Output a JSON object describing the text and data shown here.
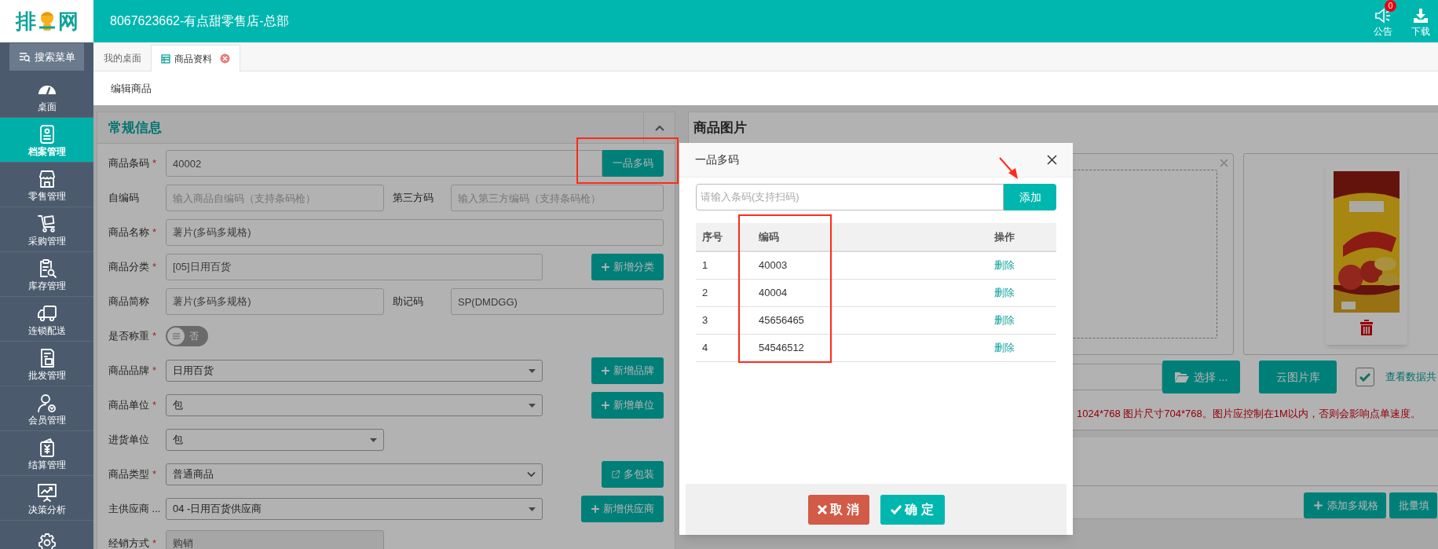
{
  "logo": {
    "left": "排",
    "right": "网"
  },
  "header": {
    "title": "8067623662-有点甜零售店-总部",
    "notice": {
      "label": "公告",
      "badge": "0"
    },
    "download": {
      "label": "下载"
    }
  },
  "sidebar": {
    "search": "搜索菜单",
    "items": [
      {
        "label": "桌面",
        "selected": false
      },
      {
        "label": "档案管理",
        "selected": true
      },
      {
        "label": "零售管理",
        "selected": false
      },
      {
        "label": "采购管理",
        "selected": false
      },
      {
        "label": "库存管理",
        "selected": false
      },
      {
        "label": "连锁配送",
        "selected": false
      },
      {
        "label": "批发管理",
        "selected": false
      },
      {
        "label": "会员管理",
        "selected": false
      },
      {
        "label": "结算管理",
        "selected": false
      },
      {
        "label": "决策分析",
        "selected": false
      },
      {
        "selected": false
      }
    ]
  },
  "tabs": [
    {
      "label": "我的桌面",
      "selected": false,
      "closable": false
    },
    {
      "label": "商品资料",
      "selected": true,
      "closable": true
    }
  ],
  "breadcrumb": "编辑商品",
  "general": {
    "title": "常规信息",
    "rows": [
      {
        "kind": "input_addon",
        "label": "商品条码",
        "mark": "*",
        "value": "40002",
        "button": "一品多码"
      },
      {
        "kind": "pair",
        "fields": [
          {
            "label": "自编码",
            "placeholder": "输入商品自编码（支持条码枪）"
          },
          {
            "label": "第三方码",
            "placeholder": "输入第三方编码（支持条码枪）"
          }
        ]
      },
      {
        "kind": "input",
        "label": "商品名称",
        "mark": "*",
        "value": "薯片(多码多规格)"
      },
      {
        "kind": "input",
        "label": "商品分类",
        "mark": "*",
        "value": "[05]日用百货",
        "action": {
          "kind": "add",
          "label": "新增分类"
        }
      },
      {
        "kind": "pair",
        "fields": [
          {
            "label": "商品简称",
            "value": "薯片(多码多规格)"
          },
          {
            "label": "助记码",
            "value": "SP(DMDGG)"
          }
        ]
      },
      {
        "kind": "toggle",
        "label": "是否称重",
        "mark": "*",
        "on": false,
        "state_label": "否"
      },
      {
        "kind": "select",
        "label": "商品品牌",
        "mark": "*",
        "value": "日用百货",
        "action": {
          "kind": "add",
          "label": "新增品牌"
        }
      },
      {
        "kind": "select",
        "label": "商品单位",
        "mark": "*",
        "value": "包",
        "action": {
          "kind": "add",
          "label": "新增单位"
        }
      },
      {
        "kind": "select_short",
        "label": "进货单位",
        "value": "包"
      },
      {
        "kind": "native_select",
        "label": "商品类型",
        "mark": "*",
        "value": "普通商品",
        "action": {
          "kind": "open",
          "label": "多包装"
        }
      },
      {
        "kind": "select",
        "label": "主供应商 ...",
        "value": "04 -日用百货供应商",
        "action": {
          "kind": "add",
          "label": "新增供应商"
        }
      },
      {
        "kind": "input_short",
        "label": "经销方式",
        "mark": "*",
        "value": "购销",
        "disabled": true
      }
    ]
  },
  "images": {
    "title": "商品图片",
    "choose": "选择 ...",
    "cloud": "云图片库",
    "share": {
      "checked": true,
      "label": "查看数据共"
    },
    "hint": "1024*768 图片尺寸704*768。图片应控制在1M以内，否则会影响点单速度。",
    "buttons": [
      {
        "kind": "add",
        "label": "添加多规格"
      },
      {
        "kind": "plain",
        "label": "批量填"
      }
    ]
  },
  "dialog": {
    "title": "一品多码",
    "placeholder": "请输入条码(支持扫码)",
    "add": "添加",
    "columns": [
      "序号",
      "编码",
      "操作"
    ],
    "rows": [
      {
        "index": "1",
        "code": "40003",
        "action": "删除"
      },
      {
        "index": "2",
        "code": "40004",
        "action": "删除"
      },
      {
        "index": "3",
        "code": "45656465",
        "action": "删除"
      },
      {
        "index": "4",
        "code": "54546512",
        "action": "删除"
      }
    ],
    "buttons": [
      {
        "kind": "cancel",
        "label": "取 消"
      },
      {
        "kind": "confirm",
        "label": "确 定"
      }
    ]
  }
}
